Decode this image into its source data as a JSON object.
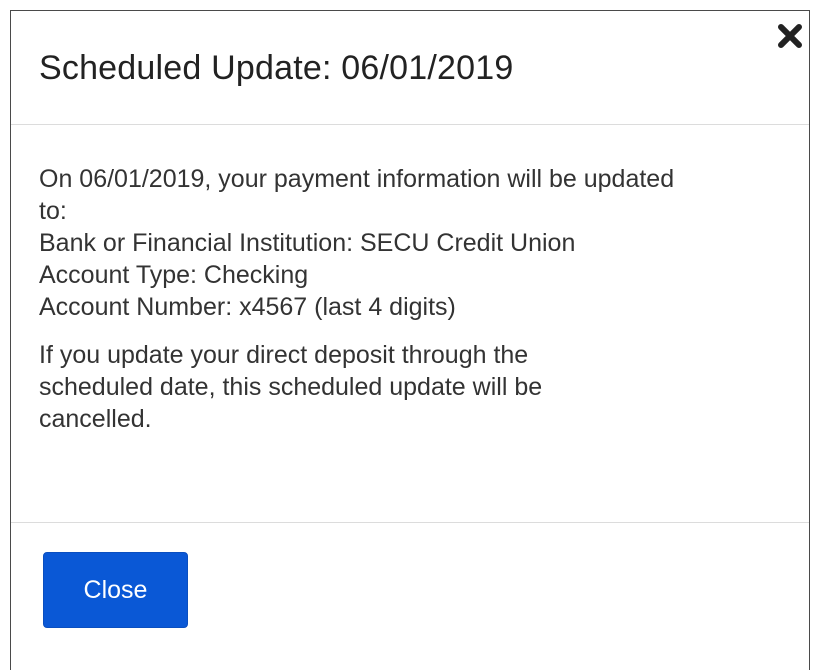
{
  "dialog": {
    "title": "Scheduled Update: 06/01/2019",
    "close_icon": "close-x-icon"
  },
  "body": {
    "intro": "On 06/01/2019, your payment information will be updated to:",
    "bank_line": "Bank or Financial Institution: SECU Credit Union",
    "account_type_line": "Account Type: Checking",
    "account_number_line": "Account Number: x4567 (last 4 digits)",
    "notice": "If you update your direct deposit through the scheduled date, this scheduled update will be cancelled."
  },
  "footer": {
    "close_label": "Close"
  },
  "colors": {
    "primary_button": "#0a58d6",
    "border": "#4a4a4a",
    "divider": "#dcdcdc"
  }
}
